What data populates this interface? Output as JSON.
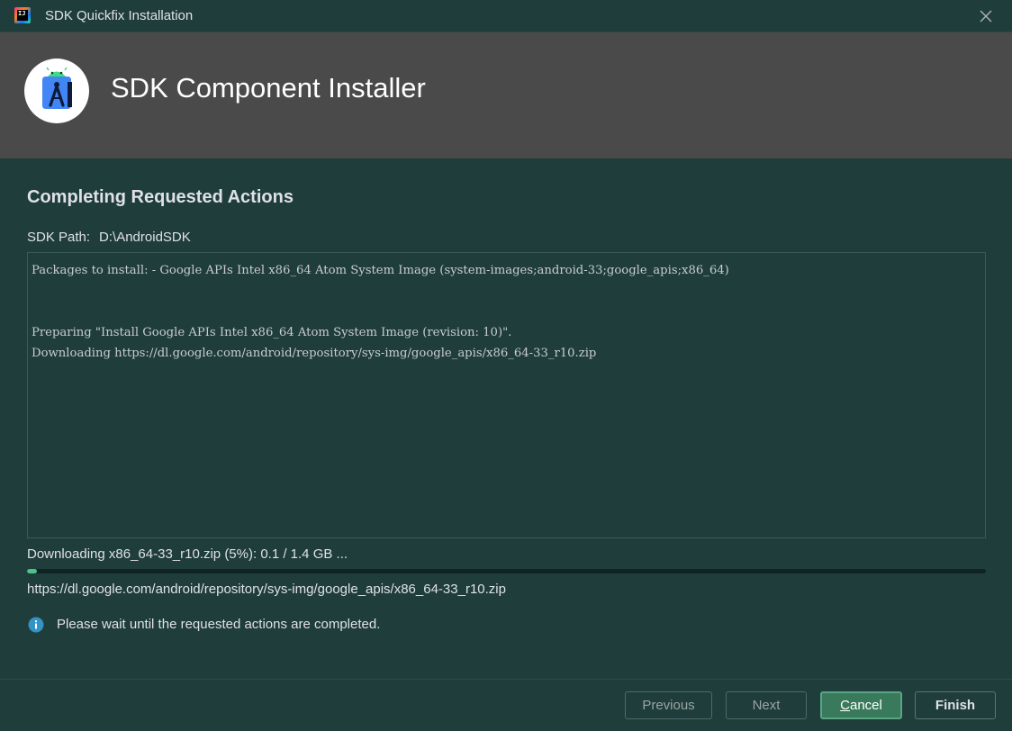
{
  "window": {
    "title": "SDK Quickfix Installation",
    "app_icon_text": "IJ"
  },
  "banner": {
    "title": "SDK Component Installer"
  },
  "main": {
    "heading": "Completing Requested Actions",
    "sdk_path_label": "SDK Path:",
    "sdk_path_value": "D:\\AndroidSDK",
    "log_lines": [
      "Packages to install: - Google APIs Intel x86_64 Atom System Image (system-images;android-33;google_apis;x86_64)",
      "",
      "",
      "Preparing \"Install Google APIs Intel x86_64 Atom System Image (revision: 10)\".",
      "Downloading https://dl.google.com/android/repository/sys-img/google_apis/x86_64-33_r10.zip"
    ],
    "progress_label": "Downloading x86_64-33_r10.zip (5%): 0.1 / 1.4 GB ...",
    "progress_fraction": 0.01,
    "url": "https://dl.google.com/android/repository/sys-img/google_apis/x86_64-33_r10.zip",
    "info_text": "Please wait until the requested actions are completed."
  },
  "footer": {
    "previous_label": "Previous",
    "next_label": "Next",
    "cancel_mnemonic": "C",
    "cancel_rest": "ancel",
    "finish_label": "Finish"
  },
  "colors": {
    "background": "#1f3d3b",
    "banner": "#4a4a4a",
    "progress": "#4ec287",
    "info_icon": "#3592c4",
    "primary_button": "#3a7a5c"
  }
}
